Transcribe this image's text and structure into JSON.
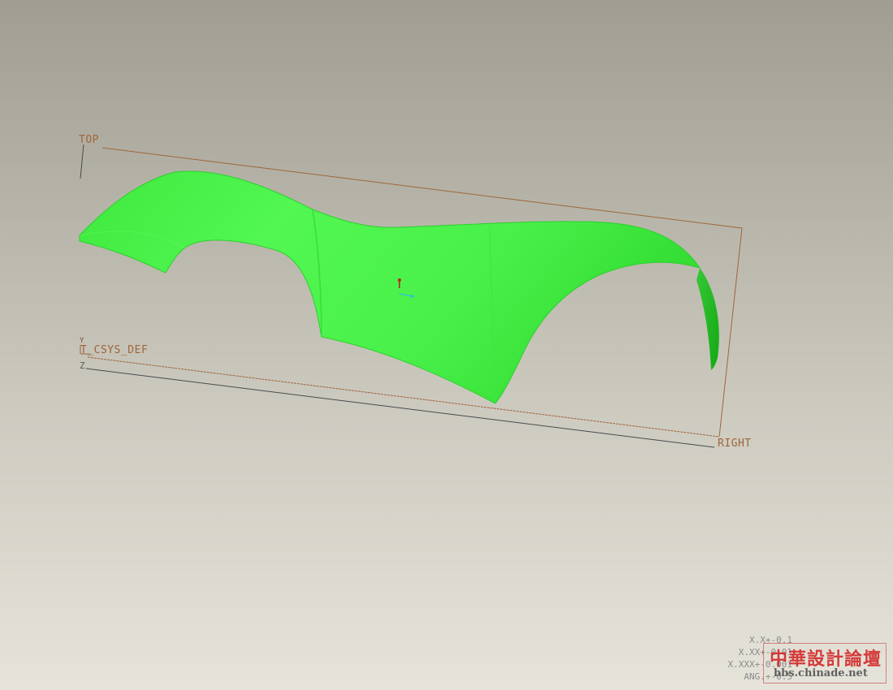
{
  "datum_planes": {
    "top_label": "TOP",
    "right_label": "RIGHT"
  },
  "coordinate_system": {
    "label": "T_CSYS_DEF",
    "axis_z": "Z",
    "axis_y": "Y"
  },
  "tolerances": [
    "X.X+-0.1",
    "X.XX+-0.01",
    "X.XXX+-0.001",
    "ANG.+-0.5"
  ],
  "watermark": {
    "title": "中華設計論壇",
    "url": "bbs.chinade.net"
  },
  "colors": {
    "surface": "#4cf54c",
    "surface_shade": "#21d421",
    "datum": "#a0643c",
    "background_top": "#a09e92",
    "background_bottom": "#e6e4da"
  }
}
